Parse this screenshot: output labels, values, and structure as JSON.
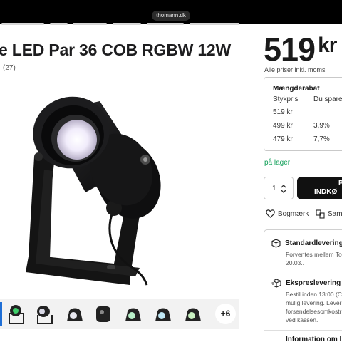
{
  "browser": {
    "url_host": "thomann.dk"
  },
  "product": {
    "title": "e LED Par 36 COB RGBW 12W",
    "rating_count": "(27)",
    "thumbnails_more": "+6"
  },
  "pricing": {
    "amount": "519",
    "currency": "kr",
    "vat_note": "Alle priser inkl. moms"
  },
  "discount": {
    "title": "Mængderabat",
    "col_price": "Stykpris",
    "col_save": "Du spare",
    "rows": [
      {
        "price": "519 kr",
        "save": ""
      },
      {
        "price": "499 kr",
        "save": "3,9%"
      },
      {
        "price": "479 kr",
        "save": "7,7%"
      }
    ]
  },
  "stock_status": "på lager",
  "purchase": {
    "quantity": "1",
    "buy_line1": "P",
    "buy_line2": "INDKØ"
  },
  "actions": {
    "wishlist": "Bogmærk",
    "compare": "Sam"
  },
  "delivery": {
    "standard_title": "Standardlevering",
    "standard_text": "Forventes mellem To\n20.03..",
    "express_title": "Ekspreslevering",
    "express_text": "Bestil inden 13:00 (C\nmulig levering. Lever\nforsendelsesomkostr\nved kassen.",
    "more_info": "Information om l"
  },
  "colors": {
    "accent_green": "#13a05a",
    "buy_button": "#111111",
    "active_thumb": "#1f6fd6"
  }
}
